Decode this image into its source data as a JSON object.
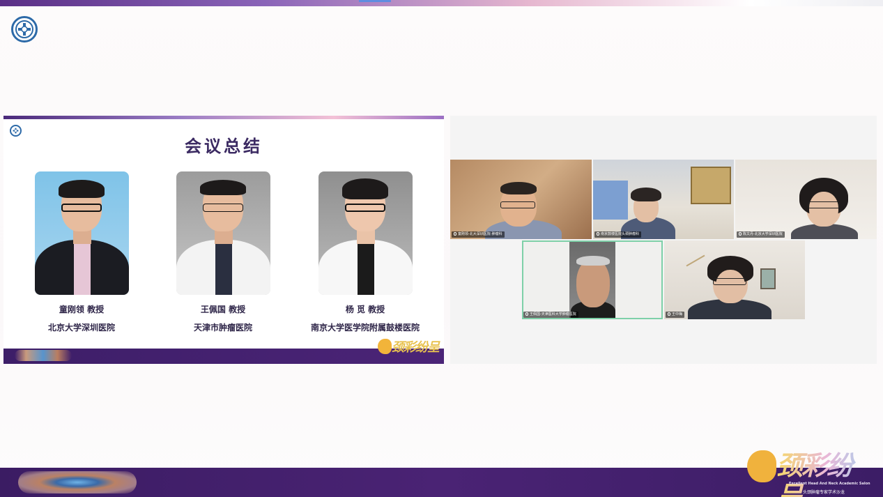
{
  "slide": {
    "title": "会议总结",
    "speakers": [
      {
        "name": "童刚领 教授",
        "hospital": "北京大学深圳医院"
      },
      {
        "name": "王佩国 教授",
        "hospital": "天津市肿瘤医院"
      },
      {
        "name": "杨 觅 教授",
        "hospital": "南京大学医学院附属鼓楼医院"
      }
    ],
    "brand": "颈彩纷呈"
  },
  "video": {
    "participants": [
      {
        "label": "童刚领-北大深圳医院-肿瘤科"
      },
      {
        "label": "南京鼓楼医院头颈肿瘤科"
      },
      {
        "label": "陈文丹-北京大学深圳医院"
      },
      {
        "label": "王佩国-天津医科大学肿瘤医院"
      },
      {
        "label": "王中梅"
      }
    ]
  },
  "footer": {
    "brand": "颈彩纷呈",
    "brand_en": "Excellent Head And Neck Academic Salon",
    "brand_cn": "头颈肿瘤专家学术沙龙"
  },
  "colors": {
    "footer_purple": "#3b1c63",
    "active_speaker": "#7ed0a8",
    "logo_blue": "#2d6aa8"
  }
}
